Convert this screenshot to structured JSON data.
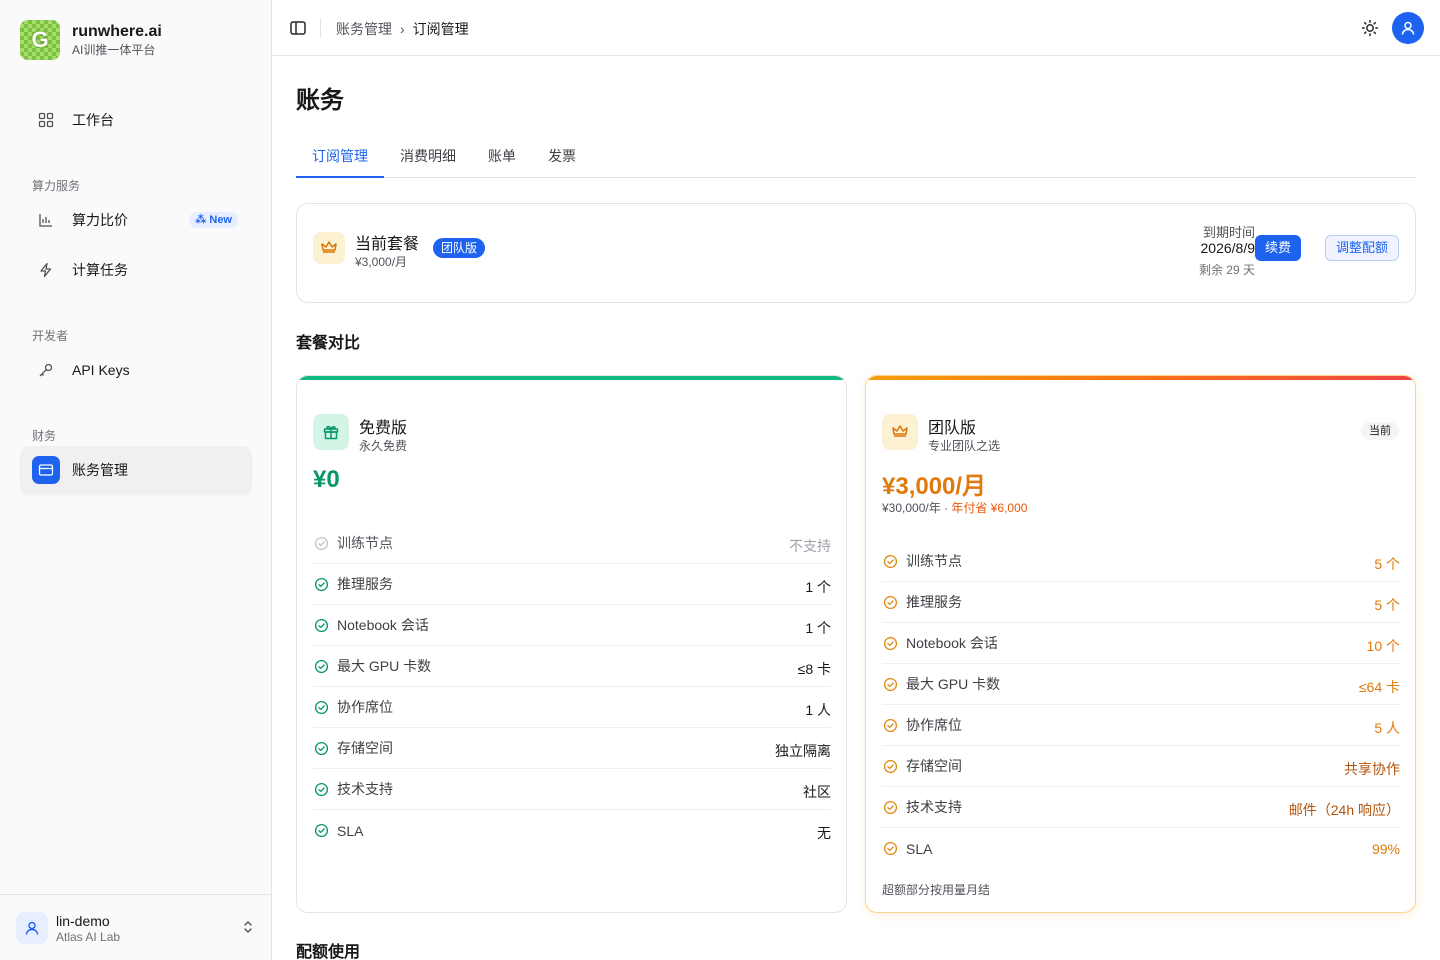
{
  "brand": {
    "name": "runwhere.ai",
    "subtitle": "AI训推一体平台",
    "logo_letter": "G"
  },
  "sidebar": {
    "workbench": "工作台",
    "sections": {
      "compute": "算力服务",
      "developer": "开发者",
      "finance": "财务"
    },
    "items": {
      "compute_compare": {
        "label": "算力比价",
        "badge": "New"
      },
      "compute_tasks": {
        "label": "计算任务"
      },
      "api_keys": {
        "label": "API Keys"
      },
      "billing": {
        "label": "账务管理"
      }
    }
  },
  "user": {
    "name": "lin-demo",
    "org": "Atlas AI Lab"
  },
  "header": {
    "breadcrumb": [
      "账务管理",
      "订阅管理"
    ]
  },
  "page": {
    "title": "账务",
    "tabs": [
      "订阅管理",
      "消费明细",
      "账单",
      "发票"
    ],
    "active_tab": "订阅管理"
  },
  "current_plan": {
    "label": "当前套餐",
    "price": "¥3,000/月",
    "badge": "团队版",
    "expire_label": "到期时间",
    "expire_date": "2026/8/9",
    "remaining": "剩余 29 天",
    "renew_button": "续费",
    "adjust_button": "调整配额"
  },
  "comparison": {
    "title": "套餐对比",
    "free": {
      "name": "免费版",
      "subtitle": "永久免费",
      "price": "¥0",
      "features": [
        {
          "label": "训练节点",
          "value": "不支持",
          "enabled": false
        },
        {
          "label": "推理服务",
          "value": "1 个",
          "enabled": true
        },
        {
          "label": "Notebook 会话",
          "value": "1 个",
          "enabled": true
        },
        {
          "label": "最大 GPU 卡数",
          "value": "≤8 卡",
          "enabled": true
        },
        {
          "label": "协作席位",
          "value": "1 人",
          "enabled": true
        },
        {
          "label": "存储空间",
          "value": "独立隔离",
          "enabled": true
        },
        {
          "label": "技术支持",
          "value": "社区",
          "enabled": true
        },
        {
          "label": "SLA",
          "value": "无",
          "enabled": true
        }
      ]
    },
    "team": {
      "name": "团队版",
      "subtitle": "专业团队之选",
      "price": "¥3,000/月",
      "yearly": "¥30,000/年 · ",
      "yearly_saving": "年付省 ¥6,000",
      "current_badge": "当前",
      "features": [
        {
          "label": "训练节点",
          "value": "5 个"
        },
        {
          "label": "推理服务",
          "value": "5 个"
        },
        {
          "label": "Notebook 会话",
          "value": "10 个"
        },
        {
          "label": "最大 GPU 卡数",
          "value": "≤64 卡"
        },
        {
          "label": "协作席位",
          "value": "5 人"
        },
        {
          "label": "存储空间",
          "value": "共享协作"
        },
        {
          "label": "技术支持",
          "value": "邮件（24h 响应）"
        },
        {
          "label": "SLA",
          "value": "99%"
        }
      ],
      "footnote": "超额部分按用量月结"
    }
  },
  "quota": {
    "title": "配额使用"
  },
  "colors": {
    "primary": "#1d63f0",
    "free_green": "#059669",
    "team_orange": "#e07a0c"
  }
}
